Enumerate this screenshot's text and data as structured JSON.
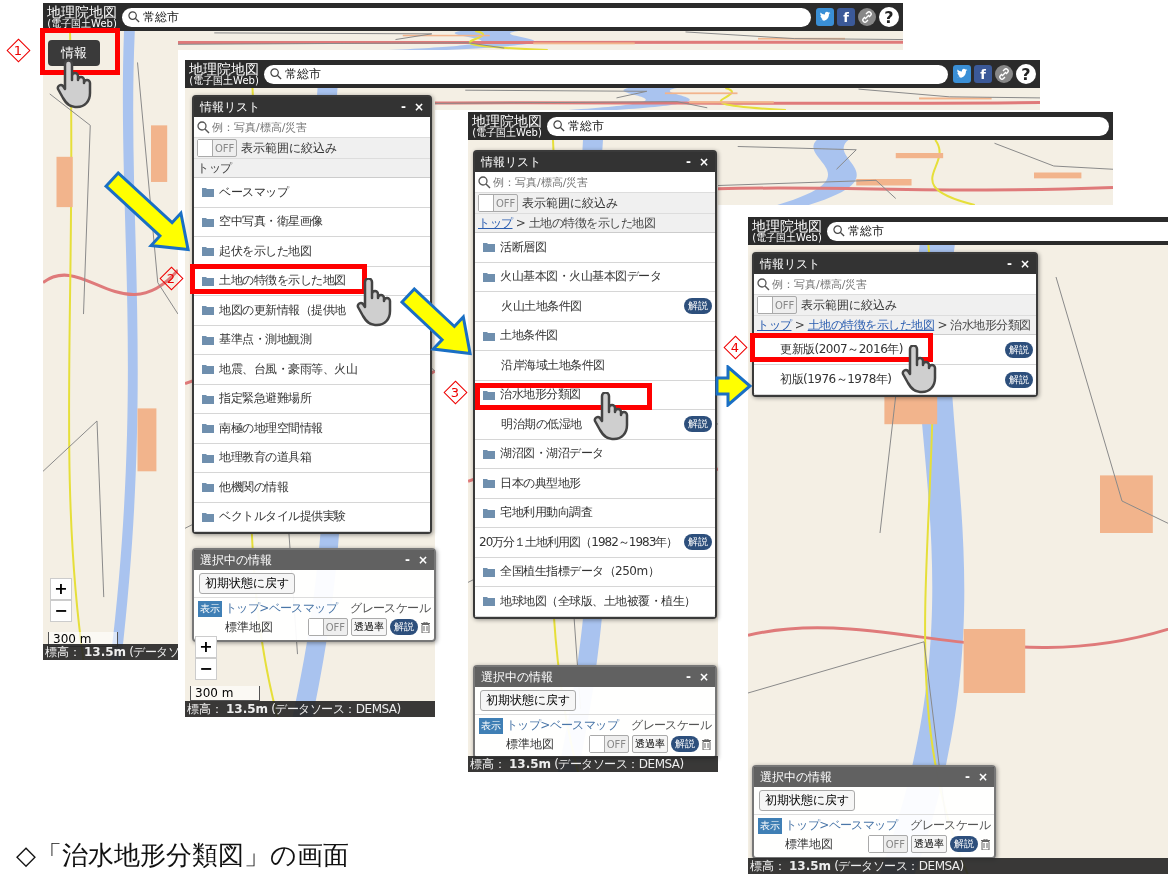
{
  "screens": [
    {
      "logo": "地理院地図",
      "logo_sub": "(電子国土Web)",
      "search": "常総市",
      "share": [
        {
          "kind": "twitter"
        },
        {
          "kind": "facebook",
          "label": "f"
        },
        {
          "kind": "link"
        },
        {
          "kind": "help",
          "label": "?"
        }
      ],
      "info_button": "情報",
      "zoom": [
        "+",
        "−"
      ],
      "scale": "300 m",
      "status": {
        "label": "標高：",
        "value": "13.5m",
        "source": "(データソ"
      }
    },
    {
      "logo": "地理院地図",
      "logo_sub": "(電子国土Web)",
      "search": "常総市",
      "share": [
        {
          "kind": "twitter"
        },
        {
          "kind": "facebook",
          "label": "f"
        },
        {
          "kind": "link"
        },
        {
          "kind": "help",
          "label": "?"
        }
      ],
      "info_list": {
        "title": "情報リスト",
        "minimize": "-",
        "close": "×",
        "search_placeholder": "例：写真/標高/災害",
        "filter": {
          "on": false,
          "toggle_label": "OFF",
          "label": "表示範囲に絞込み"
        },
        "breadcrumb": [
          {
            "text": "トップ",
            "link": false
          }
        ],
        "items": [
          {
            "kind": "folder",
            "label": "ベースマップ"
          },
          {
            "kind": "folder",
            "label": "空中写真・衛星画像"
          },
          {
            "kind": "folder",
            "label": "起伏を示した地図"
          },
          {
            "kind": "folder",
            "label": "土地の特徴を示した地図"
          },
          {
            "kind": "folder",
            "label": "地図の更新情報（提供地"
          },
          {
            "kind": "folder",
            "label": "基準点・測地観測"
          },
          {
            "kind": "folder",
            "label": "地震、台風・豪雨等、火山"
          },
          {
            "kind": "folder",
            "label": "指定緊急避難場所"
          },
          {
            "kind": "folder",
            "label": "南極の地理空間情報"
          },
          {
            "kind": "folder",
            "label": "地理教育の道具箱"
          },
          {
            "kind": "folder",
            "label": "他機関の情報"
          },
          {
            "kind": "folder",
            "label": "ベクトルタイル提供実験"
          }
        ]
      },
      "selected_panel": {
        "title": "選択中の情報",
        "minimize": "-",
        "close": "×",
        "reset_button": "初期状態に戻す",
        "layer": {
          "tag": "表示",
          "path": "トップ>ベースマップ",
          "name": "標準地図",
          "option_label": "グレースケール",
          "grayscale": {
            "on": false,
            "label": "OFF"
          },
          "opacity_button": "透過率",
          "badge": "解説"
        }
      },
      "zoom": [
        "+",
        "−"
      ],
      "scale": "300 m",
      "status": {
        "label": "標高：",
        "value": "13.5m",
        "source": "(データソース：DEMSA)"
      }
    },
    {
      "logo": "地理院地図",
      "logo_sub": "(電子国土Web)",
      "search": "常総市",
      "info_list": {
        "title": "情報リスト",
        "minimize": "-",
        "close": "×",
        "search_placeholder": "例：写真/標高/災害",
        "filter": {
          "on": false,
          "toggle_label": "OFF",
          "label": "表示範囲に絞込み"
        },
        "breadcrumb": [
          {
            "text": "トップ",
            "link": true
          },
          {
            "text": " > 土地の特徴を示した地図",
            "link": false
          }
        ],
        "items": [
          {
            "kind": "folder",
            "label": "活断層図"
          },
          {
            "kind": "folder",
            "label": "火山基本図・火山基本図データ"
          },
          {
            "kind": "layer",
            "label": "火山土地条件図",
            "badge": "解説"
          },
          {
            "kind": "folder",
            "label": "土地条件図"
          },
          {
            "kind": "layer",
            "label": "沿岸海域土地条件図"
          },
          {
            "kind": "folder",
            "label": "治水地形分類図"
          },
          {
            "kind": "layer",
            "label": "明治期の低湿地",
            "badge": "解説"
          },
          {
            "kind": "folder",
            "label": "湖沼図・湖沼データ"
          },
          {
            "kind": "folder",
            "label": "日本の典型地形"
          },
          {
            "kind": "folder",
            "label": "宅地利用動向調査"
          },
          {
            "kind": "layer",
            "label": "20万分１土地利用図（1982～1983年）",
            "badge": "解説"
          },
          {
            "kind": "folder",
            "label": "全国植生指標データ（250m）"
          },
          {
            "kind": "folder",
            "label": "地球地図（全球版、土地被覆・植生）"
          }
        ]
      },
      "selected_panel": {
        "title": "選択中の情報",
        "minimize": "-",
        "close": "×",
        "reset_button": "初期状態に戻す",
        "layer": {
          "tag": "表示",
          "path": "トップ>ベースマップ",
          "name": "標準地図",
          "option_label": "グレースケール",
          "grayscale": {
            "on": false,
            "label": "OFF"
          },
          "opacity_button": "透過率",
          "badge": "解説"
        }
      },
      "status": {
        "label": "標高：",
        "value": "13.5m",
        "source": "(データソース：DEMSA)"
      }
    },
    {
      "logo": "地理院地図",
      "logo_sub": "(電子国土Web)",
      "search": "常総市",
      "info_list": {
        "title": "情報リスト",
        "minimize": "-",
        "close": "×",
        "search_placeholder": "例：写真/標高/災害",
        "filter": {
          "on": false,
          "toggle_label": "OFF",
          "label": "表示範囲に絞込み"
        },
        "breadcrumb": [
          {
            "text": "トップ",
            "link": true
          },
          {
            "text": " > ",
            "link": false
          },
          {
            "text": "土地の特徴を示した地図",
            "link": true
          },
          {
            "text": " > 治水地形分類図",
            "link": false
          }
        ],
        "items": [
          {
            "kind": "layer",
            "label": "更新版(2007～2016年)",
            "badge": "解説"
          },
          {
            "kind": "layer",
            "label": "初版(1976～1978年)",
            "badge": "解説"
          }
        ]
      },
      "selected_panel": {
        "title": "選択中の情報",
        "minimize": "-",
        "close": "×",
        "reset_button": "初期状態に戻す",
        "layer": {
          "tag": "表示",
          "path": "トップ>ベースマップ",
          "name": "標準地図",
          "option_label": "グレースケール",
          "grayscale": {
            "on": false,
            "label": "OFF"
          },
          "opacity_button": "透過率",
          "badge": "解説"
        }
      },
      "status": {
        "label": "標高：",
        "value": "13.5m",
        "source": "(データソース：DEMSA)"
      }
    }
  ],
  "steps": [
    {
      "number": "1"
    },
    {
      "number": "2"
    },
    {
      "number": "3"
    },
    {
      "number": "4"
    }
  ],
  "caption": "◇「治水地形分類図」の画面"
}
